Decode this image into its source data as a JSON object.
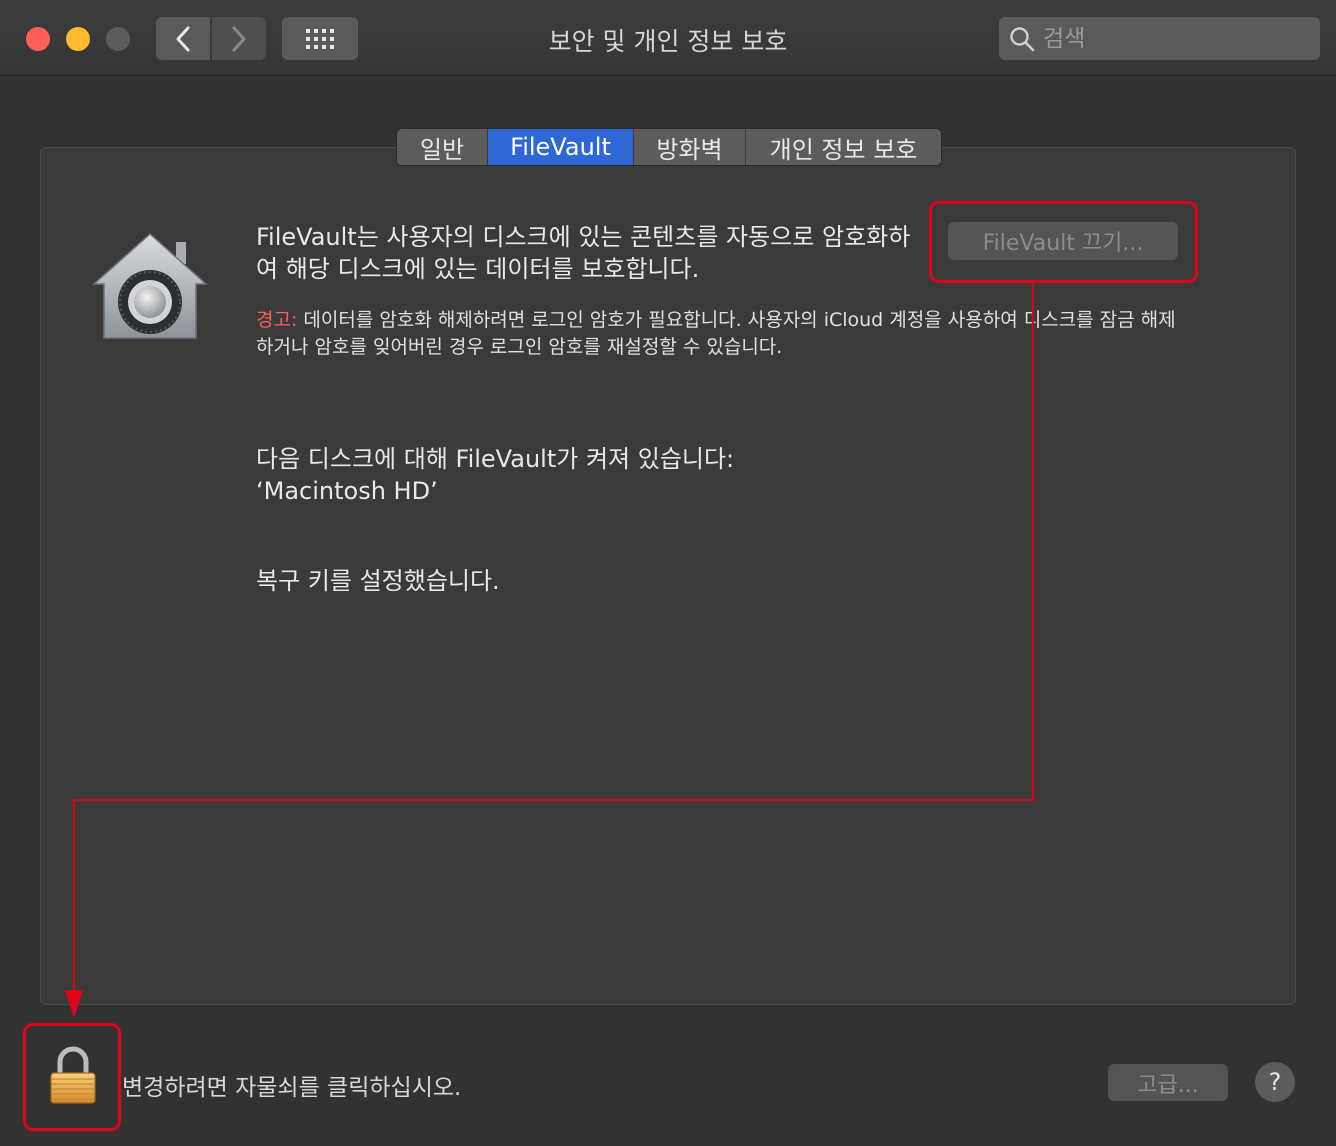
{
  "window": {
    "title": "보안 및 개인 정보 보호",
    "search_placeholder": "검색"
  },
  "tabs": [
    {
      "label": "일반",
      "active": false
    },
    {
      "label": "FileVault",
      "active": true
    },
    {
      "label": "방화벽",
      "active": false
    },
    {
      "label": "개인 정보 보호",
      "active": false
    }
  ],
  "filevault": {
    "description": "FileVault는 사용자의 디스크에 있는 콘텐츠를 자동으로 암호화하여 해당 디스크에 있는 데이터를 보호합니다.",
    "warning_label": "경고:",
    "warning_text": " 데이터를 암호화 해제하려면 로그인 암호가 필요합니다. 사용자의 iCloud 계정을 사용하여 디스크를 잠금 해제하거나 암호를 잊어버린 경우 로그인 암호를 재설정할 수 있습니다.",
    "turn_off_label": "FileVault 끄기...",
    "status_line1": "다음 디스크에 대해 FileVault가 켜져 있습니다:",
    "status_line2": "‘Macintosh HD’",
    "recovery_status": "복구 키를 설정했습니다."
  },
  "footer": {
    "lock_text": "변경하려면 자물쇠를 클릭하십시오.",
    "advanced_label": "고급...",
    "help_label": "?"
  },
  "icons": {
    "lock": "padlock-icon",
    "house": "filevault-house-icon",
    "search": "magnifier-icon"
  },
  "colors": {
    "accent": "#2f67d7",
    "warning": "#ff5f57",
    "annotation": "#e3001b"
  }
}
